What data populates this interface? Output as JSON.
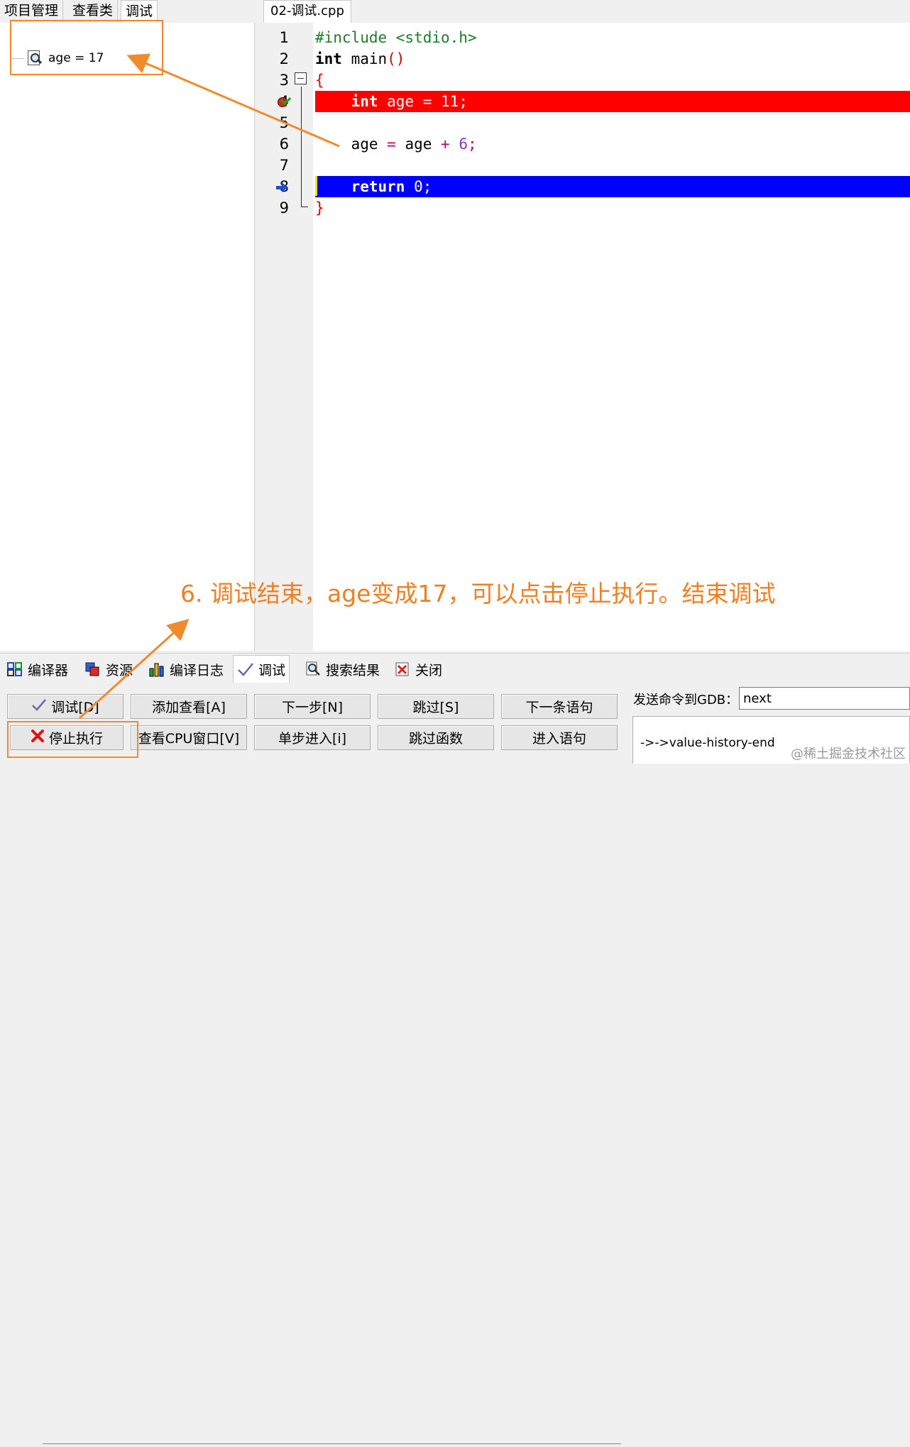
{
  "left_tabs": [
    "项目管理",
    "查看类",
    "调试"
  ],
  "watch": {
    "expression": "age = 17"
  },
  "editor": {
    "tab_title": "02-调试.cpp",
    "line_numbers": [
      "1",
      "2",
      "3",
      "4",
      "5",
      "6",
      "7",
      "8",
      "9"
    ],
    "lines": {
      "l1_directive": "#include <stdio.h>",
      "l2_type": "int",
      "l2_name": " main",
      "l2_parens": "()",
      "l3_brace": "{",
      "l4_type": "int",
      "l4_var": " age ",
      "l4_eq": "=",
      "l4_num": " 11",
      "l4_semi": ";",
      "l6_var": "age ",
      "l6_eq": "=",
      "l6_var2": " age ",
      "l6_plus": "+",
      "l6_num": " 6",
      "l6_semi": ";",
      "l8_kw": "return",
      "l8_num": " 0",
      "l8_semi": ";",
      "l9_brace": "}"
    },
    "breakpoint_line_color": "#ff0000",
    "current_line_color": "#0000ff"
  },
  "annotation": {
    "text": "6. 调试结束，age变成17，可以点击停止执行。结束调试",
    "color": "#f07f22"
  },
  "bottom_tabs": [
    "编译器",
    "资源",
    "编译日志",
    "调试",
    "搜索结果",
    "关闭"
  ],
  "debug_buttons": {
    "debug": "调试[D]",
    "add_watch": "添加查看[A]",
    "next_step": "下一步[N]",
    "skip": "跳过[S]",
    "next_statement": "下一条语句",
    "stop": "停止执行",
    "view_cpu": "查看CPU窗口[V]",
    "step_into": "单步进入[i]",
    "skip_function": "跳过函数",
    "into_statement": "进入语句"
  },
  "gdb": {
    "label": "发送命令到GDB：",
    "input_value": "next",
    "output": "->->value-history-end"
  },
  "watermark": "@稀土掘金技术社区"
}
